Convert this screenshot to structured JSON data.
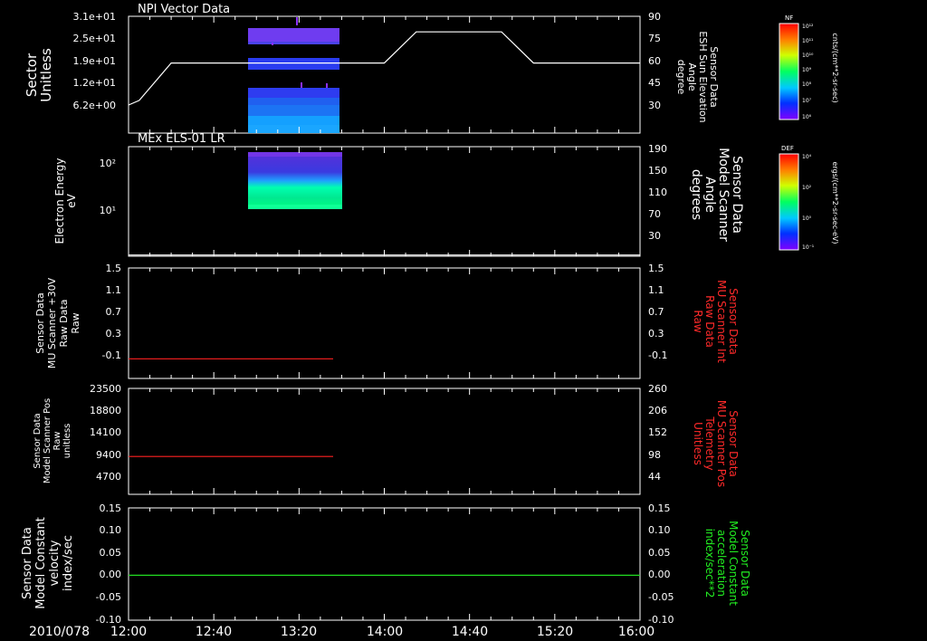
{
  "date_label": "2010/078",
  "time_axis": {
    "start": "12:00",
    "end": "16:00",
    "ticks": [
      "12:00",
      "12:40",
      "13:20",
      "14:00",
      "14:40",
      "15:20",
      "16:00"
    ]
  },
  "colors": {
    "frame": "#ffffff",
    "red_trace": "#ff2020",
    "green_trace": "#22dd22",
    "red_label": "#ff2a2a",
    "green_label": "#22ee22"
  },
  "colorbars": [
    {
      "name": "NF",
      "unit": "cnts/(cm**2-sr-sec)",
      "ticks": [
        "10¹²",
        "10¹¹",
        "10¹⁰",
        "10⁹",
        "10⁸",
        "10⁷",
        "10⁶"
      ]
    },
    {
      "name": "DEF",
      "unit": "ergs/(cm**2-sr-sec-eV)",
      "ticks": [
        "10⁴",
        "10²",
        "10⁰",
        "10⁻¹"
      ]
    }
  ],
  "chart_data": [
    {
      "type": "heatmap",
      "title": "NPI Vector Data",
      "ylabel": [
        "Sector",
        "Unitless"
      ],
      "yticks": [
        "3.1e+01",
        "2.5e+01",
        "1.9e+01",
        "1.2e+01",
        "6.2e+00"
      ],
      "y2label": [
        "Sensor Data",
        "ESH Sun Elevation",
        "Angle",
        "degree"
      ],
      "y2ticks": [
        "90",
        "75",
        "60",
        "45",
        "30"
      ],
      "y2lim": [
        15,
        90
      ],
      "data_interval": [
        "12:50",
        "13:35"
      ],
      "overlay_line": {
        "name": "ESH Sun Elevation Angle",
        "x": [
          "12:00",
          "12:05",
          "12:20",
          "14:00",
          "14:15",
          "14:55",
          "15:10",
          "16:00"
        ],
        "y": [
          33,
          36,
          60,
          60,
          80,
          80,
          60,
          60
        ]
      }
    },
    {
      "type": "heatmap",
      "title": "MEx ELS-01 LR",
      "ylabel": [
        "Electron Energy",
        "eV"
      ],
      "yticks": [
        "10²",
        "10¹"
      ],
      "y2label": [
        "Sensor Data",
        "Model Scanner",
        "Angle",
        "degrees"
      ],
      "y2ticks": [
        "190",
        "150",
        "110",
        "70",
        "30"
      ],
      "y2lim": [
        10,
        190
      ],
      "data_interval": [
        "12:50",
        "13:35"
      ],
      "overlay_line": {
        "name": "Model Scanner Angle",
        "x": [
          "12:00",
          "16:00"
        ],
        "y": [
          12,
          12
        ]
      }
    },
    {
      "type": "line",
      "ylabel": [
        "Sensor Data",
        "MU Scanner +30V",
        "Raw Data",
        "Raw"
      ],
      "yticks": [
        "1.5",
        "1.1",
        "0.7",
        "0.3",
        "-0.1"
      ],
      "ylim": [
        -0.3,
        1.5
      ],
      "y2label": [
        "Sensor Data",
        "MU Scanner Int",
        "Raw Data",
        "Raw"
      ],
      "y2ticks": [
        "1.5",
        "1.1",
        "0.7",
        "0.3",
        "-0.1"
      ],
      "series": [
        {
          "x": [
            "12:00",
            "13:36"
          ],
          "y": [
            0.02,
            0.02
          ]
        }
      ]
    },
    {
      "type": "line",
      "ylabel": [
        "Sensor Data",
        "Model Scanner Pos",
        "Raw",
        "unitless"
      ],
      "yticks": [
        "23500",
        "18800",
        "14100",
        "9400",
        "4700"
      ],
      "ylim": [
        0,
        23500
      ],
      "y2label": [
        "Sensor Data",
        "MU Scanner Pos",
        "Telemetry",
        "Unitless"
      ],
      "y2ticks": [
        "260",
        "206",
        "152",
        "98",
        "44"
      ],
      "series": [
        {
          "x": [
            "12:00",
            "13:36"
          ],
          "y": [
            8400,
            8400
          ]
        }
      ]
    },
    {
      "type": "line",
      "ylabel": [
        "Sensor Data",
        "Model Constant",
        "velocity",
        "index/sec"
      ],
      "yticks": [
        "0.15",
        "0.10",
        "0.05",
        "0.00",
        "-0.05",
        "-0.10"
      ],
      "ylim": [
        -0.1,
        0.15
      ],
      "y2label": [
        "Sensor Data",
        "Model Constant",
        "acceleration",
        "index/sec**2"
      ],
      "y2ticks": [
        "0.15",
        "0.10",
        "0.05",
        "0.00",
        "-0.05",
        "-0.10"
      ],
      "series": [
        {
          "x": [
            "12:00",
            "16:00"
          ],
          "y": [
            0,
            0
          ]
        }
      ]
    }
  ]
}
